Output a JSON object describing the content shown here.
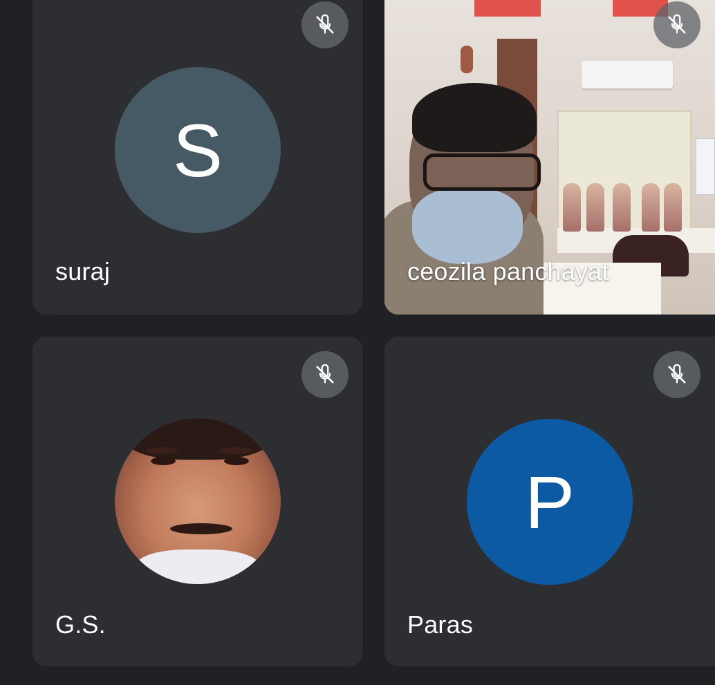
{
  "participants": [
    {
      "name": "suraj",
      "avatar_letter": "S",
      "avatar_color": "#455a64",
      "avatar_type": "letter",
      "mic_status_icon": "mic-off-icon"
    },
    {
      "name": "ceozila panchayat",
      "avatar_type": "video",
      "mic_status_icon": "mic-off-icon"
    },
    {
      "name": "G.S.",
      "avatar_type": "photo",
      "mic_status_icon": "mic-off-icon"
    },
    {
      "name": "Paras",
      "avatar_letter": "P",
      "avatar_color": "#0b5aa3",
      "avatar_type": "letter",
      "mic_status_icon": "mic-off-icon"
    }
  ],
  "colors": {
    "background": "#202124",
    "tile": "#2d2e31",
    "mute_badge": "#5f6368"
  }
}
